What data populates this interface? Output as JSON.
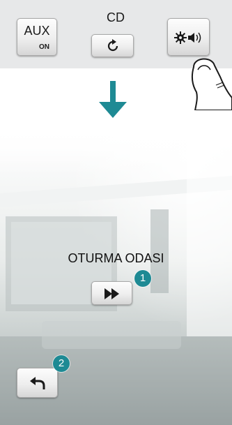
{
  "toolbar": {
    "aux": {
      "label": "AUX",
      "state": "ON"
    },
    "cd": {
      "label": "CD",
      "icon": "refresh-icon"
    },
    "settings": {
      "icon": "settings-speaker-icon"
    }
  },
  "pointer": {
    "icon": "hand-pointer-icon"
  },
  "arrow": {
    "icon": "arrow-down-icon",
    "color": "#1e8a94"
  },
  "room": {
    "title": "OTURMA ODASI",
    "forward_icon": "fast-forward-icon",
    "back_icon": "back-arrow-icon"
  },
  "badges": [
    "1",
    "2"
  ],
  "colors": {
    "accent": "#1e8a94",
    "toolbar_bg": "#e7e8e9"
  }
}
